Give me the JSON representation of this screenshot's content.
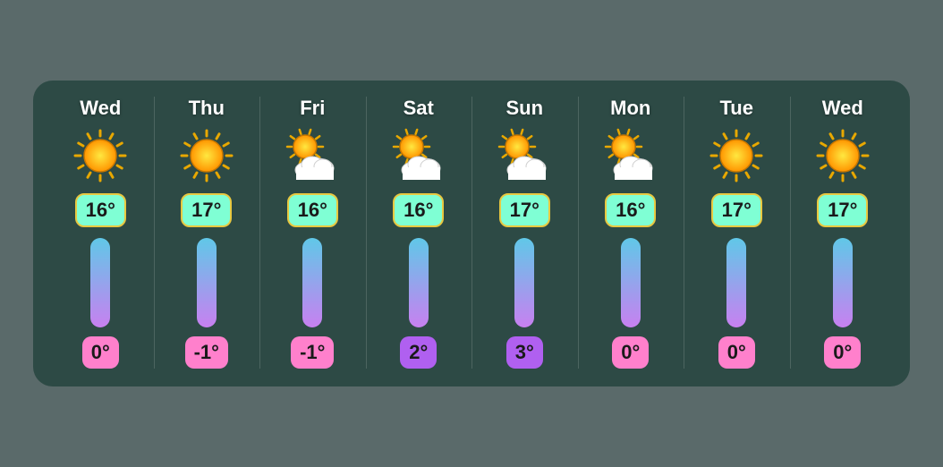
{
  "days": [
    {
      "label": "Wed",
      "icon": "sun",
      "high": "16°",
      "low": "0°",
      "lowColor": "pink"
    },
    {
      "label": "Thu",
      "icon": "sun",
      "high": "17°",
      "low": "-1°",
      "lowColor": "pink"
    },
    {
      "label": "Fri",
      "icon": "cloud-sun",
      "high": "16°",
      "low": "-1°",
      "lowColor": "pink"
    },
    {
      "label": "Sat",
      "icon": "cloud-sun",
      "high": "16°",
      "low": "2°",
      "lowColor": "purple"
    },
    {
      "label": "Sun",
      "icon": "cloud-sun",
      "high": "17°",
      "low": "3°",
      "lowColor": "purple"
    },
    {
      "label": "Mon",
      "icon": "cloud-sun",
      "high": "16°",
      "low": "0°",
      "lowColor": "pink"
    },
    {
      "label": "Tue",
      "icon": "sun",
      "high": "17°",
      "low": "0°",
      "lowColor": "pink"
    },
    {
      "label": "Wed",
      "icon": "sun",
      "high": "17°",
      "low": "0°",
      "lowColor": "pink"
    }
  ]
}
